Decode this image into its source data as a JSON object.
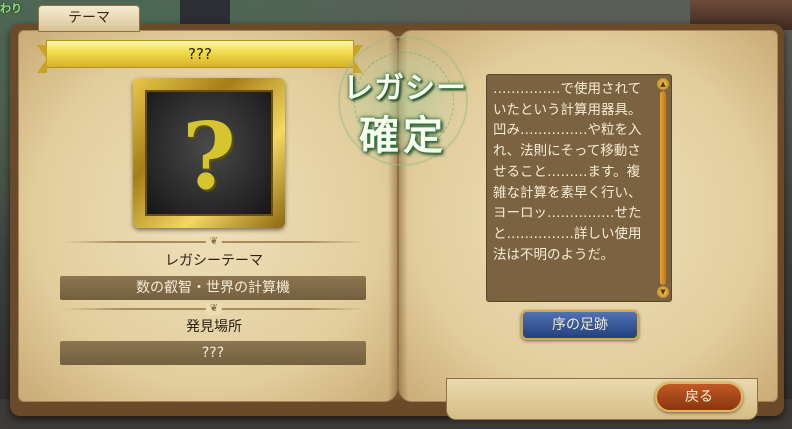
{
  "background": {
    "corner_text": "わり"
  },
  "tab": {
    "label": "テーマ"
  },
  "left_page": {
    "title": "???",
    "portrait_symbol": "?",
    "legacy_label": "レガシーテーマ",
    "legacy_value": "数の叡智・世界の計算機",
    "location_label": "発見場所",
    "location_value": "???"
  },
  "stamp": {
    "top": "レガシー",
    "main": "確定"
  },
  "right_page": {
    "description": "……………で使用されていたという計算用器具。凹み……………や粒を入れ、法則にそって移動させること………ます。複雑な計算を素早く行い、ヨーロッ……………せたと……………詳しい使用法は不明のようだ。",
    "prologue_button": "序の足跡"
  },
  "footer": {
    "back_button": "戻る"
  },
  "icons": {
    "scroll_up": "scroll-up-arrow-icon",
    "scroll_down": "scroll-down-arrow-icon",
    "divider": "ornament-icon"
  },
  "colors": {
    "ribbon": "#f1d94a",
    "value_box": "#7b6544",
    "stamp_glow": "#2f6e3c",
    "blue_button": "#2c4c8c",
    "back_button": "#a8441a"
  }
}
